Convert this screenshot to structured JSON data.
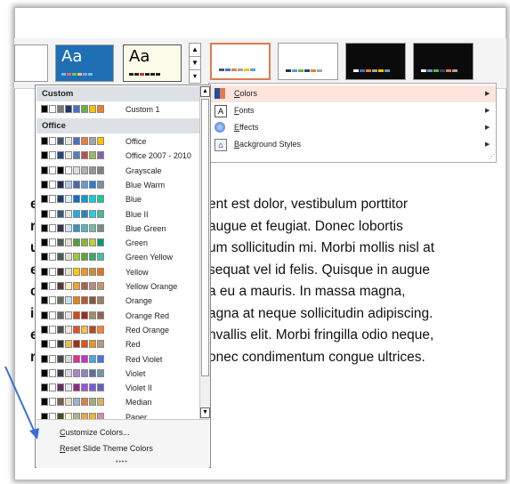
{
  "ribbon": {
    "themes": [
      {
        "label": "Aa",
        "bg": "#1f6fb5",
        "fg": "#ffffff"
      },
      {
        "label": "Aa",
        "bg": "#fbfbe9",
        "fg": "#000000"
      }
    ],
    "variants": [
      {
        "bg": "#ffffff",
        "border": "#e07b4f"
      },
      {
        "bg": "#ffffff",
        "border": "#9a9a9a"
      },
      {
        "bg": "#0b0b0b",
        "border": "#9a9a9a"
      },
      {
        "bg": "#0b0b0b",
        "border": "#9a9a9a"
      }
    ]
  },
  "menu": {
    "items": [
      {
        "label": "Colors",
        "icon": "palette-icon"
      },
      {
        "label": "Fonts",
        "icon": "font-icon"
      },
      {
        "label": "Effects",
        "icon": "effects-icon"
      },
      {
        "label": "Background Styles",
        "icon": "background-icon"
      }
    ]
  },
  "dropdown": {
    "custom_header": "Custom",
    "office_header": "Office",
    "custom_items": [
      {
        "label": "Custom 1",
        "colors": [
          "#000000",
          "#ffffff",
          "#7a7a7a",
          "#1f3864",
          "#4472c4",
          "#70ad47",
          "#ffc000",
          "#ed7d31"
        ]
      }
    ],
    "office_items": [
      {
        "label": "Office",
        "colors": [
          "#000000",
          "#ffffff",
          "#44546a",
          "#e7e6e6",
          "#4472c4",
          "#ed7d31",
          "#a5a5a5",
          "#ffc000"
        ]
      },
      {
        "label": "Office 2007 - 2010",
        "colors": [
          "#000000",
          "#ffffff",
          "#1f497d",
          "#eeece1",
          "#4f81bd",
          "#c0504d",
          "#9bbb59",
          "#8064a2"
        ]
      },
      {
        "label": "Grayscale",
        "colors": [
          "#000000",
          "#ffffff",
          "#000000",
          "#f8f8f8",
          "#dddddd",
          "#b2b2b2",
          "#969696",
          "#808080"
        ]
      },
      {
        "label": "Blue Warm",
        "colors": [
          "#000000",
          "#ffffff",
          "#242852",
          "#acccea",
          "#4a66ac",
          "#629dd1",
          "#297fd5",
          "#7f8fa9"
        ]
      },
      {
        "label": "Blue",
        "colors": [
          "#000000",
          "#ffffff",
          "#17406d",
          "#dbeff9",
          "#0f6fc6",
          "#009dd9",
          "#0bd0d9",
          "#10cf9b"
        ]
      },
      {
        "label": "Blue II",
        "colors": [
          "#000000",
          "#ffffff",
          "#335b74",
          "#dfe3e5",
          "#1cade4",
          "#2683c6",
          "#27ced7",
          "#42ba97"
        ]
      },
      {
        "label": "Blue Green",
        "colors": [
          "#000000",
          "#ffffff",
          "#373545",
          "#cee5f5",
          "#3494ba",
          "#58b6c0",
          "#75bda7",
          "#7a8c8e"
        ]
      },
      {
        "label": "Green",
        "colors": [
          "#000000",
          "#ffffff",
          "#455f51",
          "#e3ded1",
          "#549e39",
          "#8ab833",
          "#c0cf3a",
          "#029676"
        ]
      },
      {
        "label": "Green Yellow",
        "colors": [
          "#000000",
          "#ffffff",
          "#455f51",
          "#e3ded1",
          "#99cb38",
          "#63a537",
          "#37a76f",
          "#44c1a3"
        ]
      },
      {
        "label": "Yellow",
        "colors": [
          "#000000",
          "#ffffff",
          "#39302a",
          "#e5dedb",
          "#ffca08",
          "#f8931d",
          "#ce8d3e",
          "#ec7016"
        ]
      },
      {
        "label": "Yellow Orange",
        "colors": [
          "#000000",
          "#ffffff",
          "#4e3b30",
          "#fbeec9",
          "#f0a22e",
          "#a5644e",
          "#b58b80",
          "#c3986d"
        ]
      },
      {
        "label": "Orange",
        "colors": [
          "#000000",
          "#ffffff",
          "#637052",
          "#ccddea",
          "#e48312",
          "#bd582c",
          "#865640",
          "#9b8357"
        ]
      },
      {
        "label": "Orange Red",
        "colors": [
          "#000000",
          "#ffffff",
          "#696464",
          "#e9e5dc",
          "#d34817",
          "#9b2d1f",
          "#a28e6a",
          "#956251"
        ]
      },
      {
        "label": "Red Orange",
        "colors": [
          "#000000",
          "#ffffff",
          "#505046",
          "#eeece1",
          "#e84c22",
          "#ffbd47",
          "#b64926",
          "#ff8427"
        ]
      },
      {
        "label": "Red",
        "colors": [
          "#000000",
          "#ffffff",
          "#323232",
          "#e5c243",
          "#a5300f",
          "#d55816",
          "#e19825",
          "#b19c7d"
        ]
      },
      {
        "label": "Red Violet",
        "colors": [
          "#000000",
          "#ffffff",
          "#454551",
          "#d8d9dc",
          "#e32d91",
          "#c830cc",
          "#4ea6dc",
          "#4775e7"
        ]
      },
      {
        "label": "Violet",
        "colors": [
          "#000000",
          "#ffffff",
          "#373545",
          "#dcd8dc",
          "#ad84c6",
          "#8784c7",
          "#5d739a",
          "#6997af"
        ]
      },
      {
        "label": "Violet II",
        "colors": [
          "#000000",
          "#ffffff",
          "#632e62",
          "#eae5eb",
          "#92278f",
          "#9b57d3",
          "#755dd9",
          "#665eb8"
        ]
      },
      {
        "label": "Median",
        "colors": [
          "#000000",
          "#ffffff",
          "#775f55",
          "#ebddc3",
          "#94b6d2",
          "#dd8047",
          "#a5ab81",
          "#d8b25c"
        ]
      },
      {
        "label": "Paper",
        "colors": [
          "#000000",
          "#ffffff",
          "#444d26",
          "#fefac9",
          "#a5b592",
          "#f3a447",
          "#e7bc29",
          "#d092a7"
        ]
      }
    ],
    "footer": {
      "customize": "Customize Colors...",
      "reset": "Reset Slide Theme Colors"
    }
  },
  "document": {
    "lines": [
      "ent est dolor, vestibulum porttitor",
      "augue et feugiat. Donec lobortis",
      "um sollicitudin mi. Morbi mollis nisl at",
      "sequat vel id felis. Quisque in augue",
      "a eu a mauris. In massa magna,",
      "agna at neque sollicitudin adipiscing.",
      "nvallis elit. Morbi fringilla odio neque,",
      "onec condimentum congue ultrices."
    ],
    "left_letters": [
      "e",
      "r",
      "u",
      "e",
      "c",
      "i",
      "e",
      "r",
      "r"
    ]
  },
  "colors": {
    "accent": "#fde4dc",
    "arrow": "#3a6fd8"
  }
}
